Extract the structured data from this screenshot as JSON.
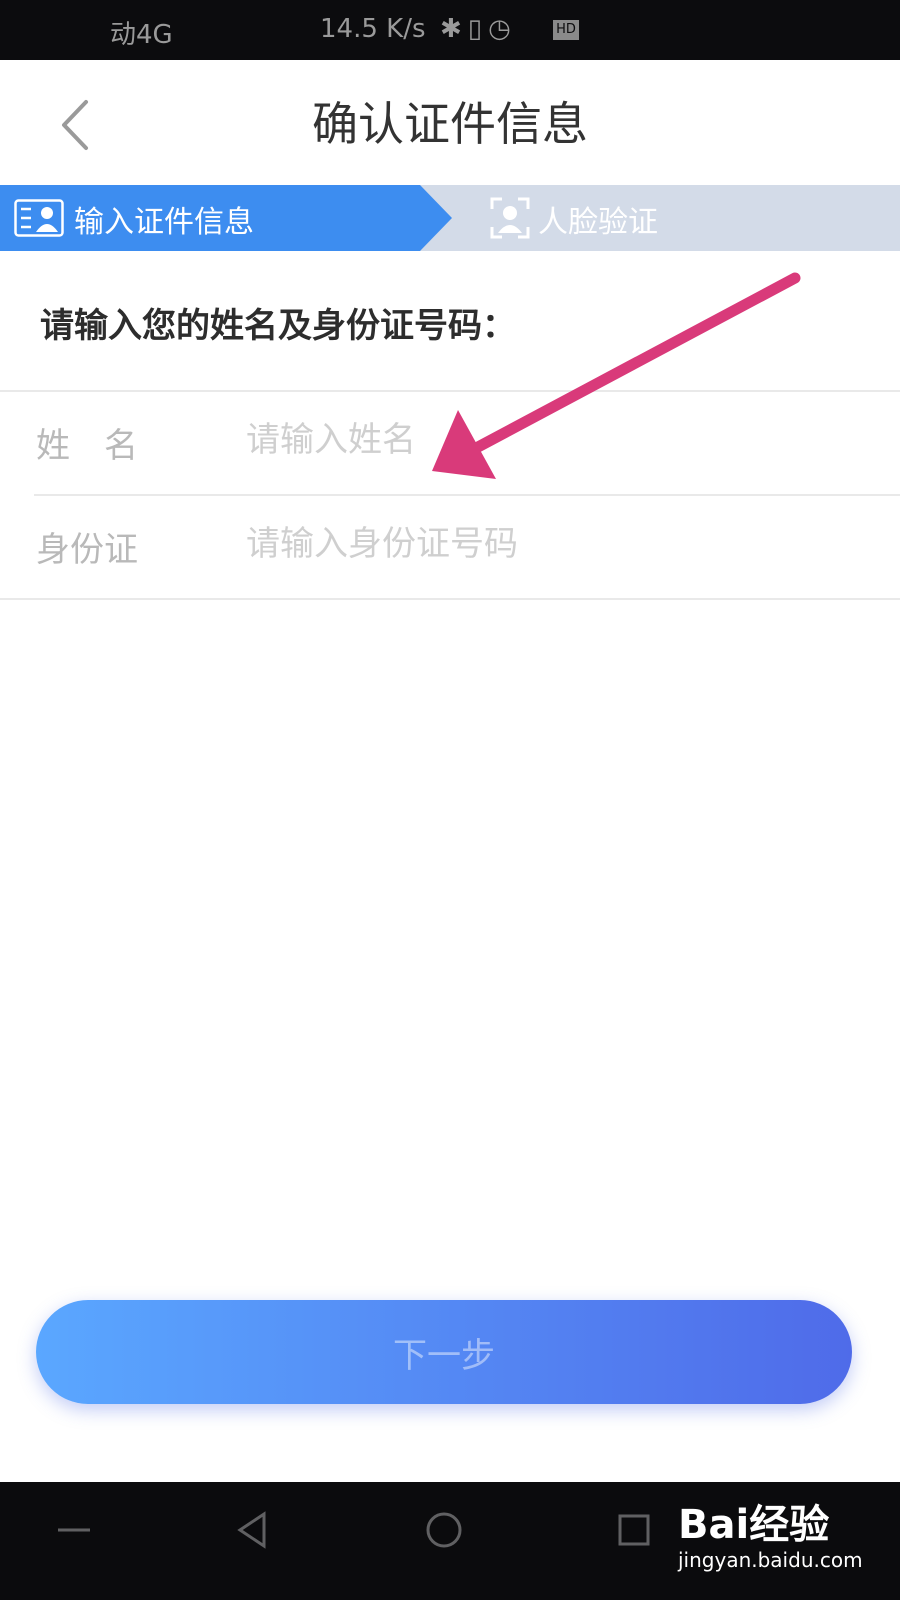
{
  "status_bar": {
    "carrier": "动4G",
    "speed": "14.5 K/s",
    "hd_badge": "HD"
  },
  "header": {
    "title": "确认证件信息",
    "back_icon": "chevron-left-icon"
  },
  "steps": [
    {
      "label": "输入证件信息",
      "icon": "id-card-icon",
      "active": true
    },
    {
      "label": "人脸验证",
      "icon": "face-scan-icon",
      "active": false
    }
  ],
  "prompt": "请输入您的姓名及身份证号码：",
  "form": {
    "name": {
      "label": "姓　名",
      "placeholder": "请输入姓名",
      "value": ""
    },
    "id_number": {
      "label": "身份证",
      "placeholder": "请输入身份证号码",
      "value": ""
    }
  },
  "next_button": {
    "label": "下一步"
  },
  "annotation": {
    "icon": "pointer-arrow-icon",
    "color": "#d93a7a"
  },
  "colors": {
    "accent": "#3d8df0",
    "step_inactive": "#d3dbe8",
    "button_start": "#5aa7ff",
    "button_end": "#4f6be9"
  },
  "watermark": {
    "logo": "Bai经验",
    "url": "jingyan.baidu.com"
  }
}
